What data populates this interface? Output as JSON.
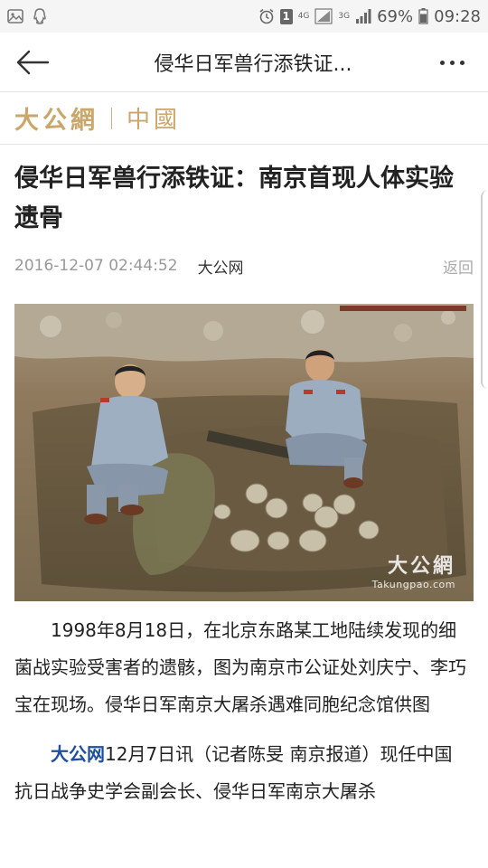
{
  "status_bar": {
    "left_icons": [
      "image-icon",
      "qq-icon"
    ],
    "net1": "4G",
    "net2": "3G",
    "sim_badge": "1",
    "battery": "69%",
    "time": "09:28"
  },
  "nav": {
    "title": "侵华日军兽行添铁证..."
  },
  "brand": {
    "logo": "大公網",
    "section": "中國",
    "color": "#c9a66b"
  },
  "article": {
    "title": "侵华日军兽行添铁证：南京首现人体实验遗骨",
    "date": "2016-12-07 02:44:52",
    "source": "大公网",
    "return_label": "返回",
    "photo": {
      "watermark_logo": "大公網",
      "watermark_url": "Takungpao.com"
    },
    "caption": "1998年8月18日，在北京东路某工地陆续发现的细菌战实验受害者的遗骸，图为南京市公证处刘庆宁、李巧宝在现场。侵华日军南京大屠杀遇难同胞纪念馆供图",
    "body_source": "大公网",
    "body_text": "12月7日讯（记者陈旻 南京报道）现任中国抗日战争史学会副会长、侵华日军南京大屠杀"
  }
}
